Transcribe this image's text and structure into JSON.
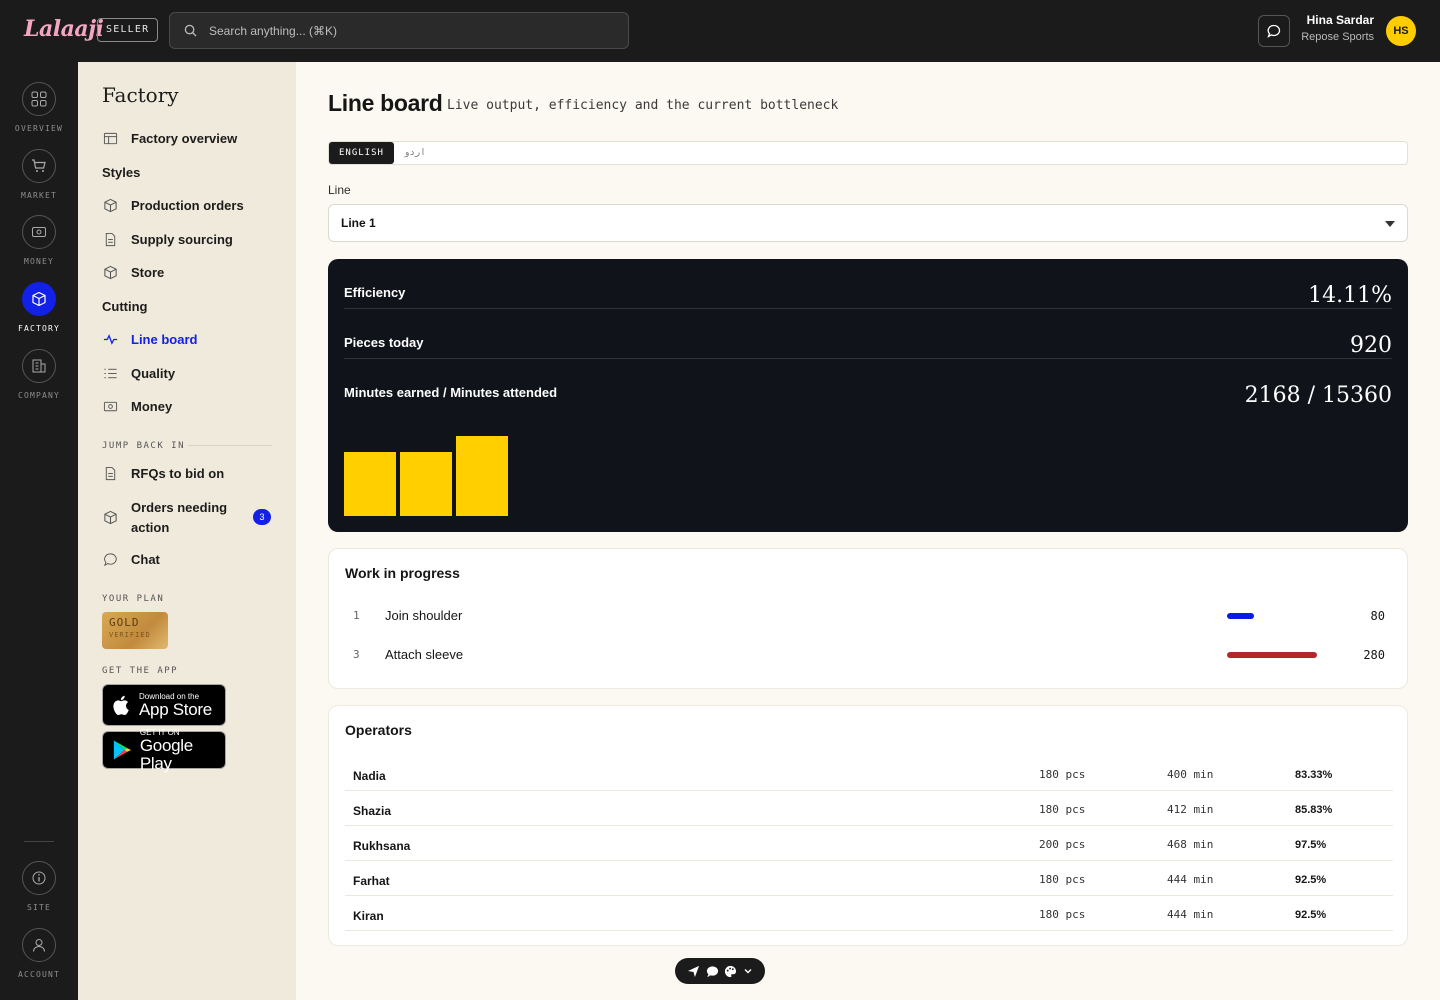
{
  "app": {
    "logo": "Lalaaji",
    "role_badge": "SELLER",
    "search_placeholder": "Search anything... (⌘K)"
  },
  "user": {
    "name": "Hina Sardar",
    "org": "Repose Sports",
    "initials": "HS"
  },
  "rail": [
    {
      "label": "OVERVIEW",
      "icon": "grid-icon"
    },
    {
      "label": "MARKET",
      "icon": "cart-icon"
    },
    {
      "label": "MONEY",
      "icon": "money-icon"
    },
    {
      "label": "FACTORY",
      "icon": "box-icon",
      "active": true
    },
    {
      "label": "COMPANY",
      "icon": "building-icon"
    },
    {
      "label": "SITE",
      "icon": "info-icon"
    },
    {
      "label": "ACCOUNT",
      "icon": "user-icon"
    }
  ],
  "sidebar": {
    "title": "Factory",
    "items": {
      "overview": "Factory overview",
      "styles": "Styles",
      "production_orders": "Production orders",
      "supply_sourcing": "Supply sourcing",
      "store": "Store",
      "cutting": "Cutting",
      "line_board": "Line board",
      "quality": "Quality",
      "money": "Money"
    },
    "jump_back_label": "JUMP BACK IN",
    "jump": {
      "rfqs": "RFQs to bid on",
      "orders_line1": "Orders needing",
      "orders_line2": "action",
      "orders_count": "3",
      "chat": "Chat"
    },
    "plan_label": "YOUR PLAN",
    "plan_name": "GOLD",
    "plan_status": "VERIFIED",
    "app_label": "GET THE APP",
    "app_store_small": "Download on the",
    "app_store_big": "App Store",
    "play_small": "GET IT ON",
    "play_big": "Google Play"
  },
  "main": {
    "title": "Line board",
    "subtitle": "Live output, efficiency and the current bottleneck",
    "lang_tabs": [
      "ENGLISH",
      "اردو"
    ],
    "line_label": "Line",
    "line_value": "Line 1",
    "metrics": {
      "efficiency_label": "Efficiency",
      "efficiency_value": "14.11%",
      "pieces_label": "Pieces today",
      "pieces_value": "920",
      "minutes_label": "Minutes earned / Minutes attended",
      "minutes_value": "2168 / 15360"
    },
    "output_bars": [
      64,
      64,
      80
    ],
    "wip": {
      "title": "Work in progress",
      "rows": [
        {
          "index": "1",
          "name": "Join shoulder",
          "count": "80",
          "fill": 0.28,
          "color": "#0a1be8"
        },
        {
          "index": "3",
          "name": "Attach sleeve",
          "count": "280",
          "fill": 0.94,
          "color": "#b3262b"
        }
      ]
    },
    "operators": {
      "title": "Operators",
      "rows": [
        {
          "name": "Nadia",
          "pcs": "180 pcs",
          "min": "400 min",
          "eff": "83.33%"
        },
        {
          "name": "Shazia",
          "pcs": "180 pcs",
          "min": "412 min",
          "eff": "85.83%"
        },
        {
          "name": "Rukhsana",
          "pcs": "200 pcs",
          "min": "468 min",
          "eff": "97.5%"
        },
        {
          "name": "Farhat",
          "pcs": "180 pcs",
          "min": "444 min",
          "eff": "92.5%"
        },
        {
          "name": "Kiran",
          "pcs": "180 pcs",
          "min": "444 min",
          "eff": "92.5%"
        }
      ]
    }
  },
  "colors": {
    "accent": "#1320e8",
    "bar": "#ffcf00",
    "dark": "#11131a"
  }
}
